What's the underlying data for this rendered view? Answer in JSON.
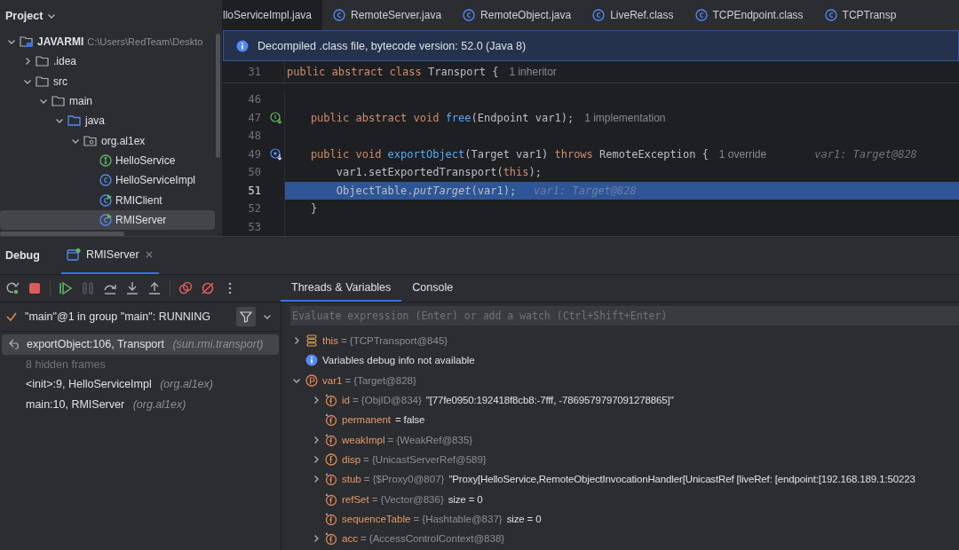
{
  "project": {
    "title": "Project",
    "tree": [
      {
        "label": "JAVARMI",
        "path": "C:\\Users\\RedTeam\\Deskto",
        "kind": "module",
        "expanded": true,
        "selected": false,
        "children": [
          {
            "label": ".idea",
            "kind": "folder",
            "expanded": false,
            "selected": false
          },
          {
            "label": "src",
            "kind": "folder",
            "expanded": true,
            "selected": false,
            "children": [
              {
                "label": "main",
                "kind": "folder",
                "expanded": true,
                "selected": false,
                "children": [
                  {
                    "label": "java",
                    "kind": "source",
                    "expanded": true,
                    "selected": false,
                    "children": [
                      {
                        "label": "org.al1ex",
                        "kind": "package",
                        "expanded": true,
                        "selected": false,
                        "children": [
                          {
                            "label": "HelloService",
                            "kind": "interface",
                            "selected": false
                          },
                          {
                            "label": "HelloServiceImpl",
                            "kind": "class",
                            "selected": false
                          },
                          {
                            "label": "RMIClient",
                            "kind": "runnable",
                            "selected": false
                          },
                          {
                            "label": "RMIServer",
                            "kind": "runnable",
                            "selected": true
                          }
                        ]
                      }
                    ]
                  }
                ]
              }
            ]
          }
        ]
      }
    ]
  },
  "editor": {
    "tabs": [
      {
        "label": "lloServiceImpl.java",
        "icon": false,
        "selected": true
      },
      {
        "label": "RemoteServer.java",
        "icon": true,
        "selected": false
      },
      {
        "label": "RemoteObject.java",
        "icon": true,
        "selected": false
      },
      {
        "label": "LiveRef.class",
        "icon": true,
        "selected": false
      },
      {
        "label": "TCPEndpoint.class",
        "icon": true,
        "selected": false
      },
      {
        "label": "TCPTransp",
        "icon": true,
        "selected": false
      }
    ],
    "banner": "Decompiled .class file, bytecode version: 52.0 (Java 8)",
    "sticky": {
      "number": "31",
      "code": [
        {
          "kind": "kw",
          "text": "public abstract class "
        },
        {
          "kind": "plain",
          "text": "Transport {"
        },
        {
          "kind": "hint",
          "text": "1 inheritor"
        }
      ]
    },
    "lines": [
      {
        "number": "46",
        "kind": "plain",
        "current": false
      },
      {
        "number": "47",
        "kind": "implemented",
        "current": false,
        "code": [
          {
            "kind": "kw",
            "text": "    public abstract void "
          },
          {
            "kind": "fn",
            "text": "free"
          },
          {
            "kind": "plain",
            "text": "(Endpoint var1);"
          },
          {
            "kind": "hint",
            "text": "1 implementation"
          }
        ]
      },
      {
        "number": "48",
        "kind": "plain",
        "current": false
      },
      {
        "number": "49",
        "kind": "overridden",
        "current": false,
        "code": [
          {
            "kind": "kw",
            "text": "    public void "
          },
          {
            "kind": "fn",
            "text": "exportObject"
          },
          {
            "kind": "plain",
            "text": "(Target var1) "
          },
          {
            "kind": "kw",
            "text": "throws "
          },
          {
            "kind": "plain",
            "text": "RemoteException {"
          },
          {
            "kind": "hint",
            "text": "1 override"
          },
          {
            "kind": "value",
            "text": "var1: Target@828"
          }
        ]
      },
      {
        "number": "50",
        "kind": "plain",
        "current": false,
        "code": [
          {
            "kind": "plain",
            "text": "        var1.setExportedTransport("
          },
          {
            "kind": "kw",
            "text": "this"
          },
          {
            "kind": "plain",
            "text": ");"
          }
        ]
      },
      {
        "number": "51",
        "kind": "plain",
        "current": true,
        "code": [
          {
            "kind": "plain",
            "text": "        ObjectTable."
          },
          {
            "kind": "italic",
            "text": "putTarget"
          },
          {
            "kind": "plain",
            "text": "(var1);"
          },
          {
            "kind": "inline",
            "text": "var1: Target@828"
          }
        ]
      },
      {
        "number": "52",
        "kind": "plain",
        "current": false,
        "code": [
          {
            "kind": "plain",
            "text": "    }"
          }
        ]
      },
      {
        "number": "53",
        "kind": "plain",
        "current": false
      }
    ]
  },
  "debug": {
    "title": "Debug",
    "tabs": [
      {
        "label": "RMIServer",
        "selected": true
      }
    ],
    "toolbar": [
      {
        "kind": "rerun"
      },
      {
        "kind": "stop"
      },
      {
        "kind": "resume"
      },
      {
        "kind": "pause"
      },
      {
        "kind": "step-over"
      },
      {
        "kind": "step-into"
      },
      {
        "kind": "step-out"
      },
      {
        "kind": "breakpoints"
      },
      {
        "kind": "mute"
      },
      {
        "kind": "more"
      }
    ],
    "view_tabs": [
      {
        "label": "Threads & Variables",
        "selected": true
      },
      {
        "label": "Console",
        "selected": false
      }
    ],
    "thread": "\"main\"@1 in group \"main\": RUNNING",
    "frames": [
      {
        "kind": "frame",
        "method": "exportObject:106, Transport",
        "package": "(sun.rmi.transport)",
        "selected": true
      },
      {
        "kind": "hidden",
        "method": "8 hidden frames",
        "selected": false
      },
      {
        "kind": "frame",
        "method": "<init>:9, HelloServiceImpl",
        "package": "(org.al1ex)",
        "selected": false
      },
      {
        "kind": "frame",
        "method": "main:10, RMIServer",
        "package": "(org.al1ex)",
        "selected": false
      }
    ],
    "evaluate": {
      "placeholder": "Evaluate expression (Enter) or add a watch (Ctrl+Shift+Enter)"
    },
    "variables": [
      {
        "kind": "object",
        "expanded": false,
        "name": "this",
        "ref": "= {TCPTransport@845}"
      },
      {
        "kind": "info",
        "name": "Variables debug info not available"
      },
      {
        "kind": "param",
        "expanded": true,
        "name": "var1",
        "ref": "= {Target@828}",
        "children": [
          {
            "kind": "final",
            "expanded": false,
            "name": "id",
            "ref": "= {ObjID@834}",
            "value": "\"[77fe0950:192418f8cb8:-7fff, -7869579797091278865]\""
          },
          {
            "kind": "final",
            "name": "permanent",
            "value": "= false"
          },
          {
            "kind": "final",
            "expanded": false,
            "name": "weakImpl",
            "ref": "= {WeakRef@835}"
          },
          {
            "kind": "field",
            "expanded": false,
            "name": "disp",
            "ref": "= {UnicastServerRef@589}"
          },
          {
            "kind": "final",
            "expanded": false,
            "name": "stub",
            "ref": "= {$Proxy0@807}",
            "value": "\"Proxy[HelloService,RemoteObjectInvocationHandler[UnicastRef [liveRef: [endpoint:[192.168.189.1:50223"
          },
          {
            "kind": "final",
            "name": "refSet",
            "ref": "= {Vector@836}",
            "value": "size = 0"
          },
          {
            "kind": "final",
            "name": "sequenceTable",
            "ref": "= {Hashtable@837}",
            "value": "size = 0"
          },
          {
            "kind": "final",
            "expanded": false,
            "name": "acc",
            "ref": "= {AccessControlContext@838}"
          }
        ]
      }
    ]
  }
}
